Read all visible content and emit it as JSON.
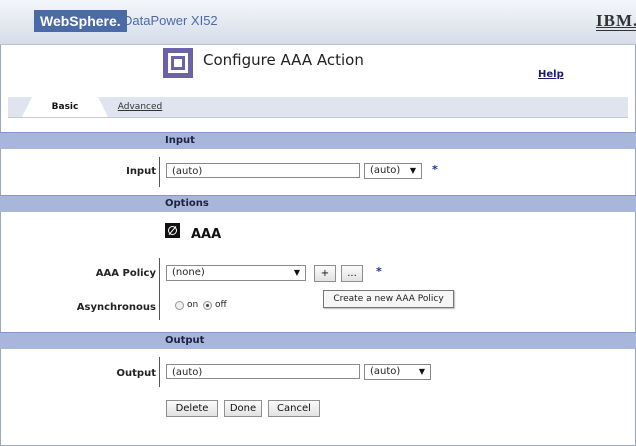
{
  "banner": {
    "brand": "WebSphere.",
    "product": "DataPower XI52",
    "vendor": "IBM."
  },
  "page": {
    "title": "Configure AAA Action",
    "help": "Help"
  },
  "tabs": [
    {
      "label": "Basic",
      "active": true
    },
    {
      "label": "Advanced",
      "active": false
    }
  ],
  "sections": {
    "input": "Input",
    "options": "Options",
    "output": "Output"
  },
  "input": {
    "label": "Input",
    "value": "(auto)",
    "context": "(auto)",
    "required": "*"
  },
  "options": {
    "heading": "AAA",
    "policy_label": "AAA Policy",
    "policy_value": "(none)",
    "add_button": "+",
    "edit_button": "...",
    "required": "*",
    "tooltip": "Create a new AAA Policy",
    "async_label": "Asynchronous",
    "async_on": "on",
    "async_off": "off",
    "async_selected": "off"
  },
  "output": {
    "label": "Output",
    "value": "(auto)",
    "context": "(auto)"
  },
  "actions": {
    "delete": "Delete",
    "done": "Done",
    "cancel": "Cancel"
  },
  "colors": {
    "section_bar": "#a9b6dc",
    "brand": "#4b6aa8",
    "title_icon": "#6b62a8"
  }
}
